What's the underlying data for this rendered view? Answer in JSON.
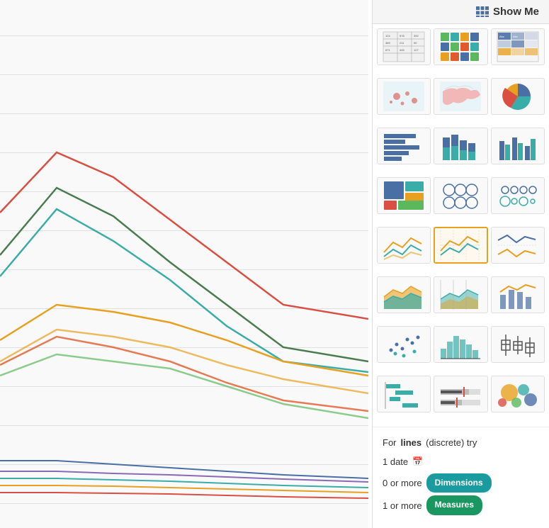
{
  "header": {
    "show_me_label": "Show Me",
    "show_me_icon": "table-icon"
  },
  "chart_types": [
    {
      "id": "text-table",
      "label": "Text table",
      "selected": false
    },
    {
      "id": "heat-map",
      "label": "Heat map",
      "selected": false
    },
    {
      "id": "highlight-table",
      "label": "Highlight table",
      "selected": false
    },
    {
      "id": "symbol-map",
      "label": "Symbol map",
      "selected": false
    },
    {
      "id": "filled-map",
      "label": "Filled map",
      "selected": false
    },
    {
      "id": "pie-chart",
      "label": "Pie chart",
      "selected": false
    },
    {
      "id": "horizontal-bars",
      "label": "Horizontal bars",
      "selected": false
    },
    {
      "id": "stacked-bars",
      "label": "Stacked bars",
      "selected": false
    },
    {
      "id": "side-by-side-bars",
      "label": "Side-by-side bars",
      "selected": false
    },
    {
      "id": "treemap",
      "label": "Treemap",
      "selected": false
    },
    {
      "id": "circle-view",
      "label": "Circle view",
      "selected": false
    },
    {
      "id": "side-by-side-circles",
      "label": "Side-by-side circles",
      "selected": false
    },
    {
      "id": "continuous-lines",
      "label": "Continuous lines",
      "selected": false
    },
    {
      "id": "discrete-lines",
      "label": "Discrete lines (lines)",
      "selected": true
    },
    {
      "id": "dual-lines",
      "label": "Dual lines",
      "selected": false
    },
    {
      "id": "area-chart",
      "label": "Area chart",
      "selected": false
    },
    {
      "id": "discrete-area",
      "label": "Discrete area",
      "selected": false
    },
    {
      "id": "dual-combination",
      "label": "Dual combination",
      "selected": false
    },
    {
      "id": "scatter-plot",
      "label": "Scatter plot",
      "selected": false
    },
    {
      "id": "histogram",
      "label": "Histogram",
      "selected": false
    },
    {
      "id": "box-whisker",
      "label": "Box and whisker plot",
      "selected": false
    },
    {
      "id": "gantt-bar",
      "label": "Gantt bar",
      "selected": false
    },
    {
      "id": "bullet",
      "label": "Bullet graph",
      "selected": false
    },
    {
      "id": "packed-bubbles",
      "label": "Packed bubbles",
      "selected": false
    }
  ],
  "footer": {
    "for_label": "For",
    "chart_type_name": "lines",
    "chart_type_detail": "(discrete) try",
    "date_label": "1 date",
    "zero_or_more": "0 or more",
    "one_or_more": "1 or more",
    "dimensions_label": "Dimensions",
    "measures_label": "Measures"
  },
  "colors": {
    "selected_border": "#e8a020",
    "badge_blue": "#1a9ba0",
    "badge_green": "#1a9660",
    "grid_line": "#e0e0e0"
  }
}
